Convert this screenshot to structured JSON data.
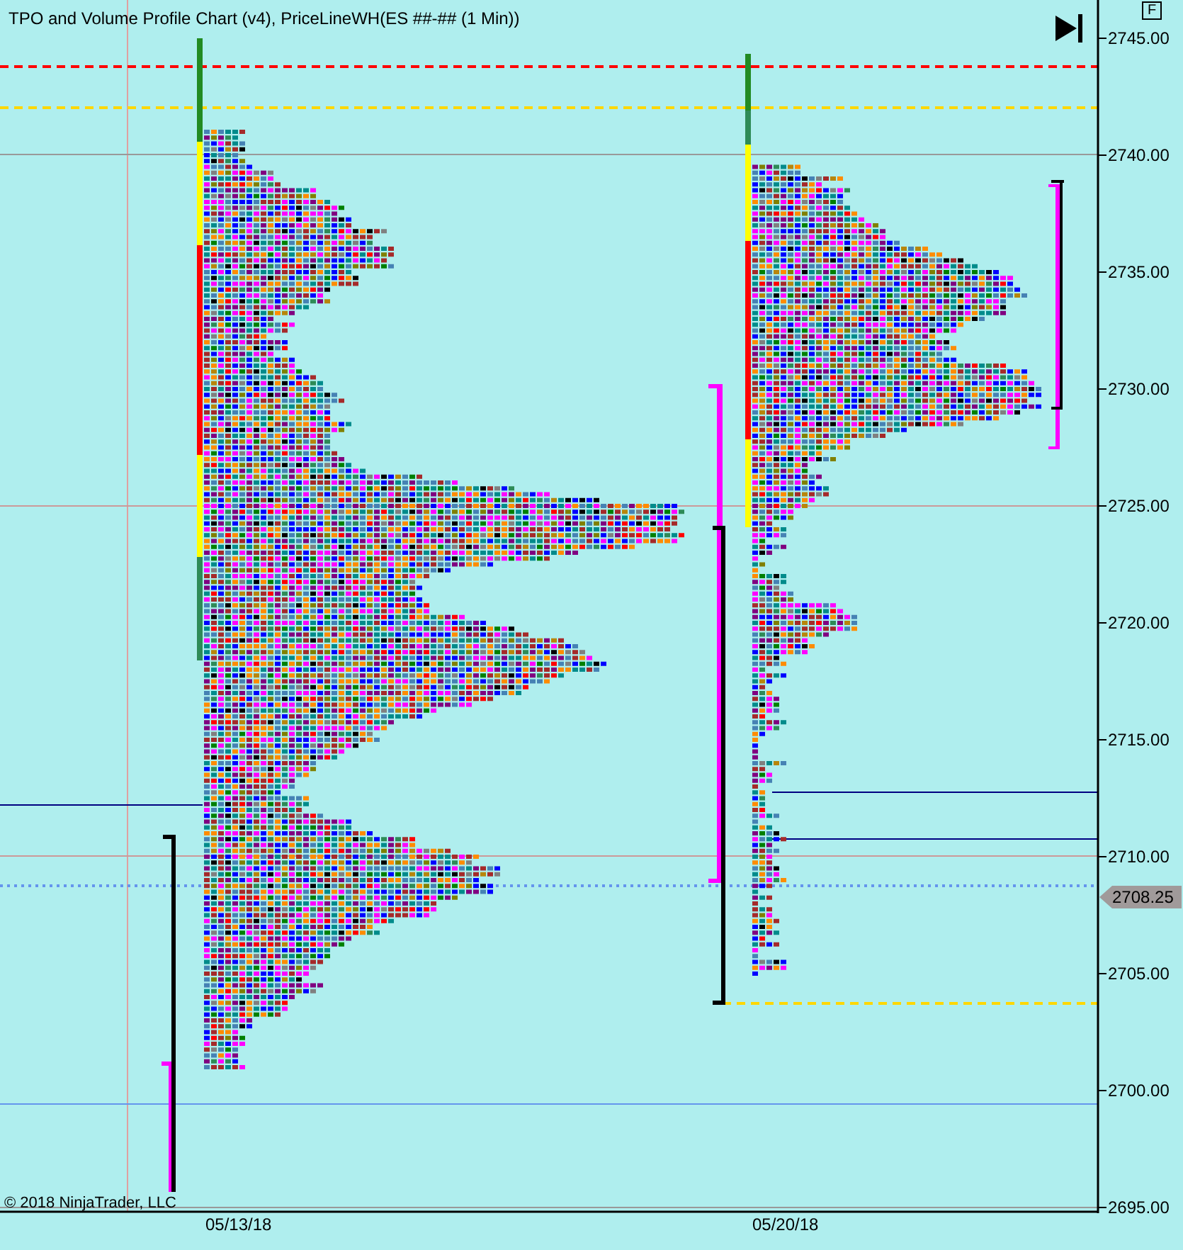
{
  "chart": {
    "title": "TPO and Volume Profile Chart (v4), PriceLineWH(ES ##-## (1 Min))",
    "corner_button": "F",
    "copyright": "© 2018 NinjaTrader, LLC",
    "y_axis_labels": [
      "2745.00",
      "2740.00",
      "2735.00",
      "2730.00",
      "2725.00",
      "2720.00",
      "2715.00",
      "2710.00",
      "2705.00",
      "2700.00",
      "2695.00"
    ],
    "last_price": "2708.25",
    "x_axis_labels": [
      "05/13/18",
      "05/20/18"
    ]
  }
}
